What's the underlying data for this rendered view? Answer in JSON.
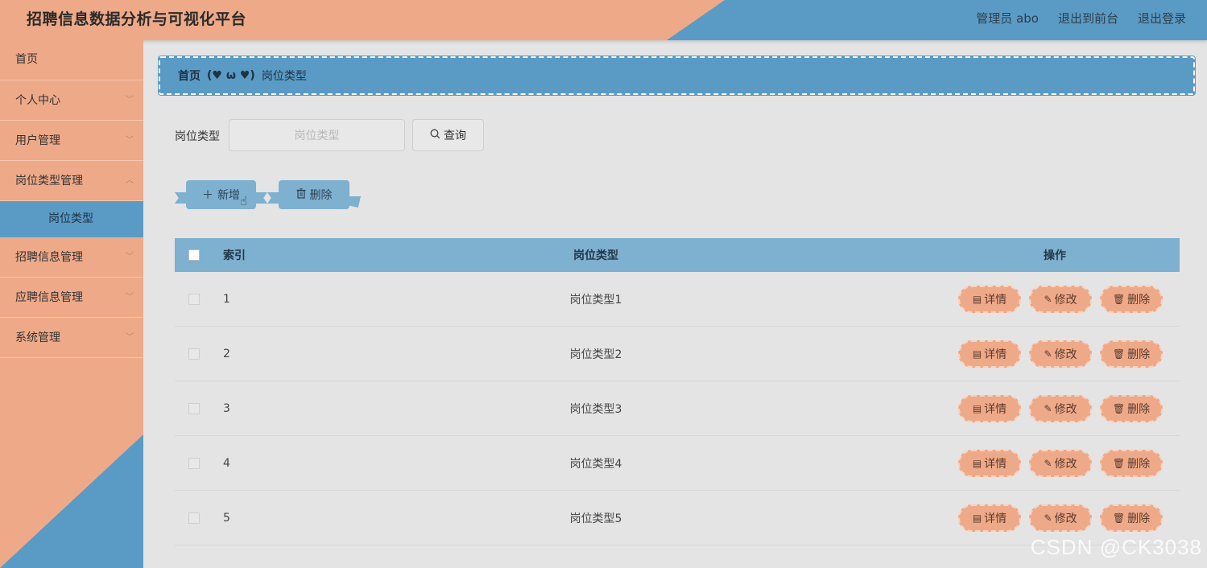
{
  "header": {
    "title": "招聘信息数据分析与可视化平台",
    "user": "管理员 abo",
    "front_link": "退出到前台",
    "logout": "退出登录"
  },
  "sidebar": {
    "items": [
      {
        "label": "首页"
      },
      {
        "label": "个人中心"
      },
      {
        "label": "用户管理"
      },
      {
        "label": "岗位类型管理"
      },
      {
        "label": "岗位类型"
      },
      {
        "label": "招聘信息管理"
      },
      {
        "label": "应聘信息管理"
      },
      {
        "label": "系统管理"
      }
    ]
  },
  "breadcrumb": {
    "home": "首页",
    "separator": "(♥ ω ♥)",
    "current": "岗位类型"
  },
  "search": {
    "label": "岗位类型",
    "placeholder": "岗位类型",
    "button": "查询"
  },
  "actions": {
    "add": "新增",
    "delete": "删除"
  },
  "table": {
    "headers": {
      "index": "索引",
      "type": "岗位类型",
      "ops": "操作"
    },
    "rows": [
      {
        "index": "1",
        "type": "岗位类型1"
      },
      {
        "index": "2",
        "type": "岗位类型2"
      },
      {
        "index": "3",
        "type": "岗位类型3"
      },
      {
        "index": "4",
        "type": "岗位类型4"
      },
      {
        "index": "5",
        "type": "岗位类型5"
      }
    ],
    "ops": {
      "detail": "详情",
      "edit": "修改",
      "delete": "删除"
    }
  },
  "watermark": "CSDN @CK3038",
  "colors": {
    "orange": "#eea988",
    "blue": "#5a9bc6",
    "light_blue": "#7eb0cf",
    "background": "#e4e4e4"
  }
}
